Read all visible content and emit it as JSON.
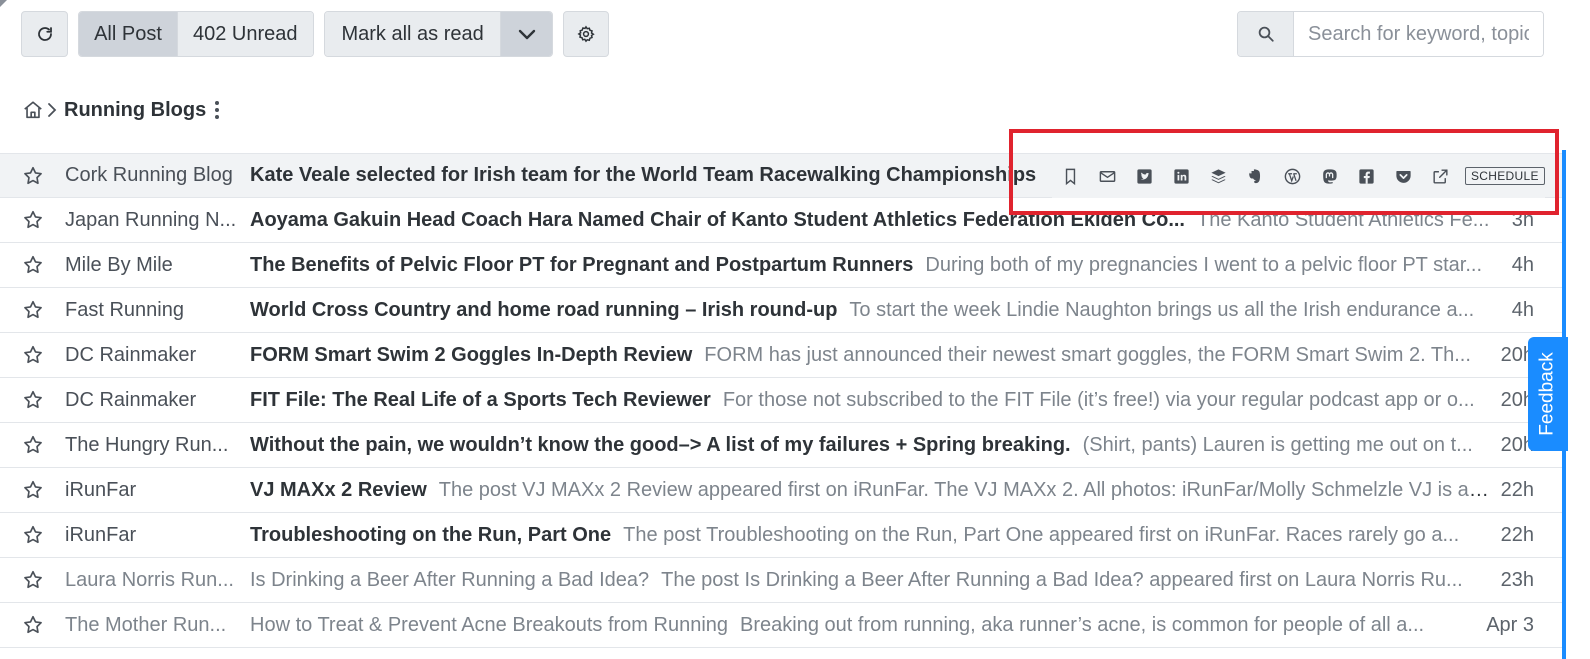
{
  "toolbar": {
    "filter_all": "All Post",
    "filter_unread": "402 Unread",
    "mark_all_read": "Mark all as read",
    "search_placeholder": "Search for keyword, topic"
  },
  "breadcrumb": {
    "title": "Running Blogs"
  },
  "hover_actions": {
    "icons": [
      "bookmark-icon",
      "mail-icon",
      "twitter-icon",
      "linkedin-icon",
      "buffer-icon",
      "evernote-icon",
      "wordpress-icon",
      "mastodon-icon",
      "facebook-icon",
      "pocket-icon",
      "external-link-icon"
    ],
    "schedule_label": "SCHEDULE"
  },
  "articles": [
    {
      "source": "Cork Running Blog",
      "title": "Kate Veale selected for Irish team for the World Team Racewalking Championships in",
      "snippet": "",
      "time": "",
      "read": false
    },
    {
      "source": "Japan Running N...",
      "title": "Aoyama Gakuin Head Coach Hara Named Chair of Kanto Student Athletics Federation Ekiden Co...",
      "snippet": "The Kanto Student Athletics Fe...",
      "time": "3h",
      "read": false
    },
    {
      "source": "Mile By Mile",
      "title": "The Benefits of Pelvic Floor PT for Pregnant and Postpartum Runners",
      "snippet": "During both of my pregnancies I went to a pelvic floor PT star...",
      "time": "4h",
      "read": false
    },
    {
      "source": "Fast Running",
      "title": "World Cross Country and home road running – Irish round-up",
      "snippet": "To start the week Lindie Naughton brings us all the Irish endurance a...",
      "time": "4h",
      "read": false
    },
    {
      "source": "DC Rainmaker",
      "title": "FORM Smart Swim 2 Goggles In-Depth Review",
      "snippet": "FORM has just announced their newest smart goggles, the FORM Smart Swim 2. Th...",
      "time": "20h",
      "read": false
    },
    {
      "source": "DC Rainmaker",
      "title": "FIT File: The Real Life of a Sports Tech Reviewer",
      "snippet": "For those not subscribed to the FIT File (it’s free!) via your regular podcast app or o...",
      "time": "20h",
      "read": false
    },
    {
      "source": "The Hungry Run...",
      "title": "Without the pain, we wouldn’t know the good–> A list of my failures + Spring breaking.",
      "snippet": "(Shirt, pants) Lauren is getting me out on t...",
      "time": "20h",
      "read": false
    },
    {
      "source": "iRunFar",
      "title": "VJ MAXx 2 Review",
      "snippet": "The post VJ MAXx 2 Review appeared first on iRunFar. The VJ MAXx 2. All photos: iRunFar/Molly Schmelzle VJ is a b...",
      "time": "22h",
      "read": false
    },
    {
      "source": "iRunFar",
      "title": "Troubleshooting on the Run, Part One",
      "snippet": "The post Troubleshooting on the Run, Part One appeared first on iRunFar. Races rarely go a...",
      "time": "22h",
      "read": false
    },
    {
      "source": "Laura Norris Run...",
      "title": "Is Drinking a Beer After Running a Bad Idea?",
      "snippet": "The post Is Drinking a Beer After Running a Bad Idea? appeared first on Laura Norris Ru...",
      "time": "23h",
      "read": true
    },
    {
      "source": "The Mother Run...",
      "title": "How to Treat & Prevent Acne Breakouts from Running",
      "snippet": "Breaking out from running, aka runner’s acne, is common for people of all a...",
      "time": "Apr 3",
      "read": true
    }
  ],
  "feedback_label": "Feedback"
}
